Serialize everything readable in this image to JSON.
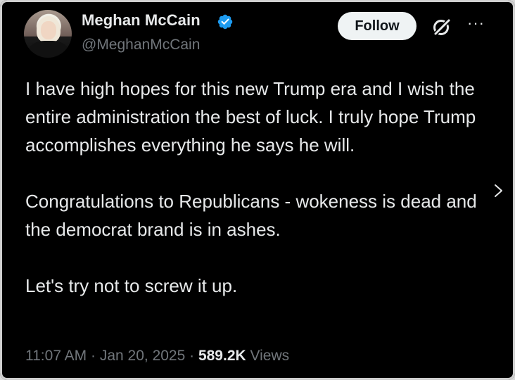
{
  "author": {
    "name": "Meghan McCain",
    "handle": "@MeghanMcCain",
    "verified": true,
    "avatar": "profile-photo"
  },
  "actions": {
    "follow_label": "Follow",
    "grok_icon": "grok-icon",
    "more_icon": "more-icon",
    "more_label": "···"
  },
  "tweet": {
    "paragraphs": [
      "I have high hopes for this new Trump era and I wish the entire administration the best of luck. I truly hope Trump accomplishes everything he says he will.",
      "Congratulations to Republicans - wokeness is dead and the democrat brand is in ashes.",
      "Let's try not to screw it up."
    ]
  },
  "meta": {
    "time": "11:07 AM",
    "separator": " · ",
    "date": "Jan 20, 2025",
    "views_count": "589.2K",
    "views_label": "Views"
  },
  "colors": {
    "background": "#000000",
    "text_primary": "#e7e9ea",
    "text_secondary": "#71767b",
    "verified_blue": "#1d9bf0",
    "follow_bg": "#eff3f4"
  }
}
